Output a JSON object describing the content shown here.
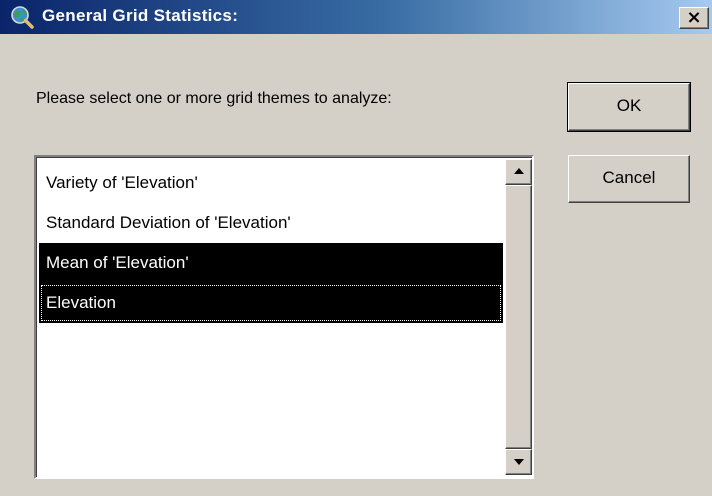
{
  "window": {
    "title": "General Grid Statistics:",
    "close_label": "×",
    "app_icon": "globe-magnifier-icon"
  },
  "prompt": "Please select one or more grid themes to analyze:",
  "buttons": {
    "ok_label": "OK",
    "cancel_label": "Cancel"
  },
  "themes": {
    "items": [
      {
        "label": "Variety of 'Elevation'",
        "selected": false
      },
      {
        "label": "Standard Deviation of 'Elevation'",
        "selected": false
      },
      {
        "label": "Mean of 'Elevation'",
        "selected": true
      },
      {
        "label": "Elevation",
        "selected": true,
        "focused": true
      }
    ]
  },
  "colors": {
    "title_gradient_start": "#0a246a",
    "title_gradient_end": "#a6caf0",
    "dialog_bg": "#d4d0c8",
    "selection_bg": "#000000"
  }
}
